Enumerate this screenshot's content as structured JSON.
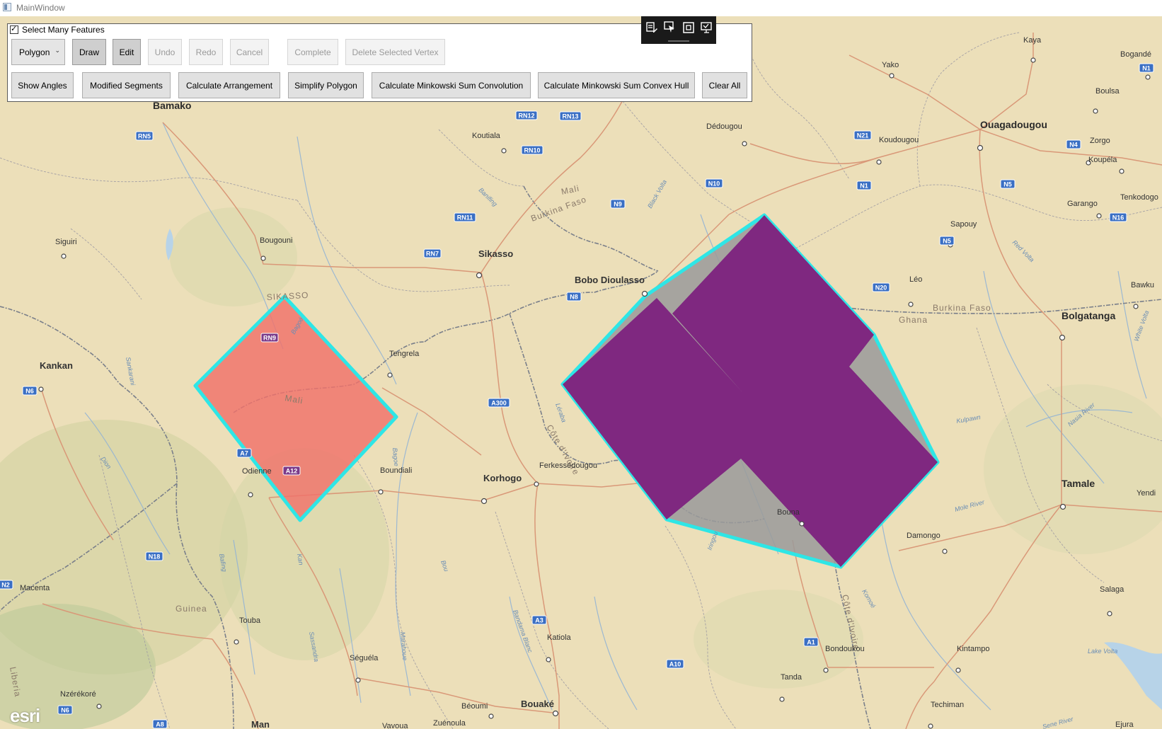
{
  "window": {
    "title": "MainWindow"
  },
  "toolbar": {
    "select_many_label": "Select Many Features",
    "select_many_checked": true,
    "geometry_type": "Polygon",
    "row1": [
      "Draw",
      "Edit",
      "Undo",
      "Redo",
      "Cancel",
      "Complete",
      "Delete Selected Vertex"
    ],
    "row2": [
      "Show Angles",
      "Modified Segments",
      "Calculate Arrangement",
      "Simplify Polygon",
      "Calculate Minkowski Sum Convolution",
      "Calculate Minkowski Sum Convex Hull",
      "Clear All"
    ]
  },
  "edit_tools": [
    "edit-geometry-icon",
    "select-vertex-icon",
    "frame-icon",
    "snap-icon"
  ],
  "map": {
    "attribution": "esri",
    "cities": [
      "Bamako",
      "Kaya",
      "Bogandé",
      "Yako",
      "Boulsa",
      "Ouagadougou",
      "Koutiala",
      "Dédougou",
      "Koudougou",
      "Zorgo",
      "Koupéla",
      "Tenkodogo",
      "Garango",
      "Sapouy",
      "Siguiri",
      "Bougouni",
      "Sikasso",
      "Bobo Dioulasso",
      "Léo",
      "Bawku",
      "Bolgatanga",
      "Kankan",
      "Tengrela",
      "Odienne",
      "Boundiali",
      "Korhogo",
      "Ferkessédougou",
      "Tamale",
      "Yendi",
      "Bouna",
      "Damongo",
      "Macenta",
      "Salaga",
      "Touba",
      "Katiola",
      "Séguéla",
      "Bondoukou",
      "Kintampo",
      "Tanda",
      "Nzérékoré",
      "Béoumi",
      "Bouaké",
      "Zuénoula",
      "Man",
      "Vavoua",
      "Techiman",
      "Ejura"
    ],
    "regions": [
      "Mali",
      "Burkina Faso",
      "Ghana",
      "SIKASSO",
      "Guinea",
      "Côte d'Ivoire",
      "Liberia"
    ],
    "rivers": [
      "Banifing",
      "Black Volta",
      "White Volta",
      "Red Volta",
      "Nasia River",
      "Mole River",
      "Lake Volta",
      "Sene River",
      "Bagoe",
      "Bandama Blanc",
      "Marahoue",
      "Sassandra",
      "Bafing",
      "Bou",
      "Kan",
      "Iringou",
      "Komoé",
      "Léraba",
      "Dion",
      "Sankarani",
      "Bagoé",
      "Kulpawn"
    ],
    "roads": [
      "RN5",
      "RN12",
      "RN13",
      "RN10",
      "RN11",
      "RN7",
      "RN9",
      "N9",
      "N10",
      "N8",
      "N21",
      "N1",
      "N4",
      "N5",
      "N18",
      "N6",
      "N16",
      "N20",
      "N2",
      "A7",
      "A12",
      "A300",
      "A3",
      "A1",
      "A10",
      "A8",
      "N1",
      "N5",
      "N6"
    ],
    "colors": {
      "land": "#ecdfb9",
      "border": "#7a7f8a",
      "road": "#d89a7a",
      "red_polygon": "#f0726a",
      "outline": "#2ee6e6",
      "purple": "#7f2880",
      "gray": "#9a9a9a"
    }
  }
}
